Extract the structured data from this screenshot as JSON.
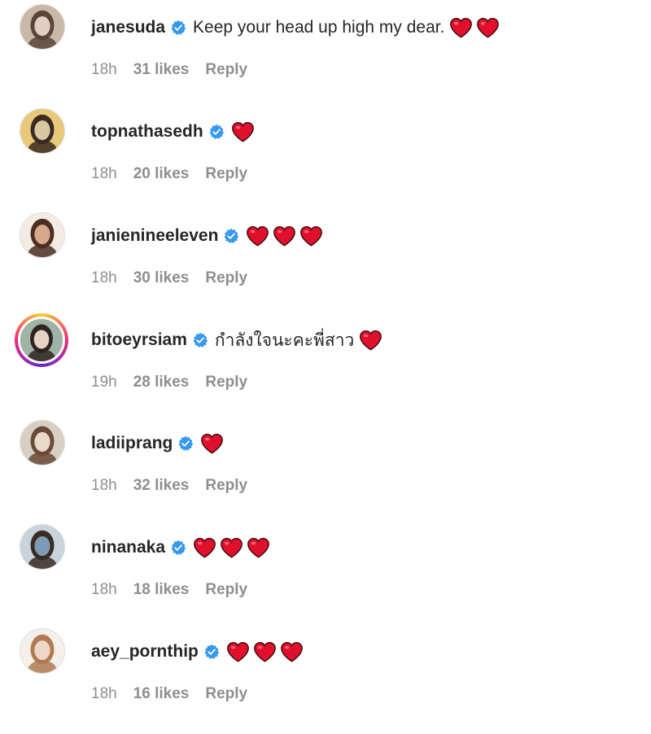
{
  "comments": [
    {
      "username": "janesuda",
      "verified": true,
      "text": "Keep your head up high my dear.",
      "hearts": 2,
      "time": "18h",
      "likes": "31 likes",
      "reply_label": "Reply",
      "story_ring": false,
      "avatar_colors": [
        "#c9b7a8",
        "#5a4638",
        "#e2cfc2"
      ]
    },
    {
      "username": "topnathasedh",
      "verified": true,
      "text": "",
      "hearts": 1,
      "time": "18h",
      "likes": "20 likes",
      "reply_label": "Reply",
      "story_ring": false,
      "avatar_colors": [
        "#e8c97a",
        "#3b2a20",
        "#d9c7a2"
      ]
    },
    {
      "username": "janienineeleven",
      "verified": true,
      "text": "",
      "hearts": 3,
      "time": "18h",
      "likes": "30 likes",
      "reply_label": "Reply",
      "story_ring": false,
      "avatar_colors": [
        "#f3ece4",
        "#4a2f22",
        "#d8a88a"
      ]
    },
    {
      "username": "bitoeyrsiam",
      "verified": true,
      "text": "กำลังใจนะคะพี่สาว",
      "hearts": 1,
      "time": "19h",
      "likes": "28 likes",
      "reply_label": "Reply",
      "story_ring": true,
      "avatar_colors": [
        "#9fb3a6",
        "#2d2620",
        "#e7d3c4"
      ]
    },
    {
      "username": "ladiiprang",
      "verified": true,
      "text": "",
      "hearts": 1,
      "time": "18h",
      "likes": "32 likes",
      "reply_label": "Reply",
      "story_ring": false,
      "avatar_colors": [
        "#d8cfc4",
        "#6a4a38",
        "#ead8c8"
      ]
    },
    {
      "username": "ninanaka",
      "verified": true,
      "text": "",
      "hearts": 3,
      "time": "18h",
      "likes": "18 likes",
      "reply_label": "Reply",
      "story_ring": false,
      "avatar_colors": [
        "#c8d3dc",
        "#3a2c24",
        "#7f9ab5"
      ]
    },
    {
      "username": "aey_pornthip",
      "verified": true,
      "text": "",
      "hearts": 3,
      "time": "18h",
      "likes": "16 likes",
      "reply_label": "Reply",
      "story_ring": false,
      "avatar_colors": [
        "#f4efea",
        "#b07a52",
        "#eed7c6"
      ]
    }
  ],
  "colors": {
    "username": "#262626",
    "meta": "#8e8e8e",
    "verified_badge": "#3897f0",
    "heart": "#e0102d"
  },
  "icons": {
    "verified": "verified-badge-icon",
    "heart": "red-heart-emoji-icon"
  }
}
